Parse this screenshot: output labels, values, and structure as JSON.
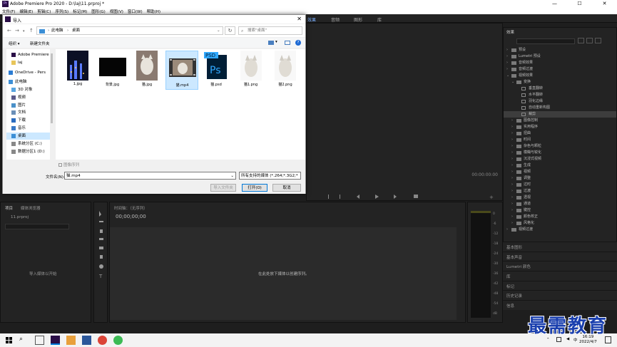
{
  "app": {
    "title": "Adobe Premiere Pro 2020 - D:\\laj\\11.prproj *",
    "icon": "Pr",
    "win_min": "—",
    "win_max": "☐",
    "win_close": "✕"
  },
  "menu": [
    "文件(F)",
    "编辑(E)",
    "剪辑(C)",
    "序列(S)",
    "标记(M)",
    "图形(G)",
    "视图(V)",
    "窗口(W)",
    "帮助(H)"
  ],
  "workspace_tabs": [
    "效果",
    "音频",
    "图形",
    "库"
  ],
  "effects_panel": {
    "title": "效果",
    "items": [
      {
        "label": "预设",
        "type": "folder",
        "level": 0,
        "expanded": false
      },
      {
        "label": "Lumetri 预设",
        "type": "folder",
        "level": 0,
        "expanded": false
      },
      {
        "label": "音频效果",
        "type": "folder",
        "level": 0,
        "expanded": false
      },
      {
        "label": "音频过渡",
        "type": "folder",
        "level": 0,
        "expanded": false
      },
      {
        "label": "视频效果",
        "type": "folder",
        "level": 0,
        "expanded": true
      },
      {
        "label": "变换",
        "type": "folder",
        "level": 1,
        "expanded": true
      },
      {
        "label": "垂直翻转",
        "type": "fx",
        "level": 2
      },
      {
        "label": "水平翻转",
        "type": "fx",
        "level": 2
      },
      {
        "label": "羽化边缘",
        "type": "fx",
        "level": 2
      },
      {
        "label": "自动重新构图",
        "type": "fx",
        "level": 2
      },
      {
        "label": "裁剪",
        "type": "fx",
        "level": 2,
        "selected": true
      },
      {
        "label": "图像控制",
        "type": "folder",
        "level": 1,
        "expanded": false
      },
      {
        "label": "实用程序",
        "type": "folder",
        "level": 1,
        "expanded": false
      },
      {
        "label": "扭曲",
        "type": "folder",
        "level": 1,
        "expanded": false
      },
      {
        "label": "时间",
        "type": "folder",
        "level": 1,
        "expanded": false
      },
      {
        "label": "杂色与颗粒",
        "type": "folder",
        "level": 1,
        "expanded": false
      },
      {
        "label": "模糊与锐化",
        "type": "folder",
        "level": 1,
        "expanded": false
      },
      {
        "label": "沉浸式视频",
        "type": "folder",
        "level": 1,
        "expanded": false
      },
      {
        "label": "生成",
        "type": "folder",
        "level": 1,
        "expanded": false
      },
      {
        "label": "视频",
        "type": "folder",
        "level": 1,
        "expanded": false
      },
      {
        "label": "调整",
        "type": "folder",
        "level": 1,
        "expanded": false
      },
      {
        "label": "过时",
        "type": "folder",
        "level": 1,
        "expanded": false
      },
      {
        "label": "过渡",
        "type": "folder",
        "level": 1,
        "expanded": false
      },
      {
        "label": "透视",
        "type": "folder",
        "level": 1,
        "expanded": false
      },
      {
        "label": "通道",
        "type": "folder",
        "level": 1,
        "expanded": false
      },
      {
        "label": "键控",
        "type": "folder",
        "level": 1,
        "expanded": false
      },
      {
        "label": "颜色校正",
        "type": "folder",
        "level": 1,
        "expanded": false
      },
      {
        "label": "风格化",
        "type": "folder",
        "level": 1,
        "expanded": false
      },
      {
        "label": "视频过渡",
        "type": "folder",
        "level": 0,
        "expanded": false
      }
    ]
  },
  "right_panels": [
    "基本图形",
    "基本声音",
    "Lumetri 颜色",
    "库",
    "标记",
    "历史记录",
    "信息"
  ],
  "program_monitor": {
    "timecode": "00:00:00:00"
  },
  "project_panel": {
    "tab1": "项目",
    "tab2": "媒体浏览器",
    "project_file": "11.prproj",
    "hint": "导入媒体以开始"
  },
  "timeline": {
    "title": "时间轴：（无序列）",
    "timecode": "00;00;00;00",
    "hint": "在此处放下媒体以创建序列。"
  },
  "audio_meter": {
    "ticks": [
      "0",
      "-6",
      "-12",
      "-18",
      "-24",
      "-30",
      "-36",
      "-42",
      "-48",
      "-54",
      "dB"
    ]
  },
  "dialog": {
    "title": "导入",
    "close": "✕",
    "breadcrumb": [
      "此电脑",
      "桌面"
    ],
    "search_placeholder": "搜索\"桌面\"",
    "organize": "组织 ▾",
    "new_folder": "新建文件夹",
    "nav": [
      {
        "label": "Adobe Premiere",
        "icon": "premiere-icon"
      },
      {
        "label": "laj",
        "icon": "folder-icon"
      },
      {
        "label": "OneDrive - Pers",
        "icon": "onedrive-icon"
      },
      {
        "label": "此电脑",
        "icon": "computer-icon"
      },
      {
        "label": "3D 对象",
        "icon": "3d-objects-icon"
      },
      {
        "label": "视频",
        "icon": "video-folder-icon"
      },
      {
        "label": "图片",
        "icon": "pictures-folder-icon"
      },
      {
        "label": "文档",
        "icon": "documents-folder-icon"
      },
      {
        "label": "下载",
        "icon": "downloads-folder-icon"
      },
      {
        "label": "音乐",
        "icon": "music-folder-icon"
      },
      {
        "label": "桌面",
        "icon": "desktop-folder-icon",
        "selected": true
      },
      {
        "label": "系统分区 (C:)",
        "icon": "drive-icon"
      },
      {
        "label": "数据分区1 (D:)",
        "icon": "drive-icon"
      }
    ],
    "files": [
      {
        "name": "1.jpg",
        "kind": "city-night"
      },
      {
        "name": "背景.jpg",
        "kind": "black"
      },
      {
        "name": "猫.jpg",
        "kind": "cat"
      },
      {
        "name": "猫.mp4",
        "kind": "video",
        "selected": true
      },
      {
        "name": "猫.psd",
        "kind": "psd"
      },
      {
        "name": "猫1.png",
        "kind": "cat-png"
      },
      {
        "name": "猫2.png",
        "kind": "cat-png"
      }
    ],
    "image_sequence": "图像序列",
    "filename_label": "文件名(N):",
    "filename_value": "猫.mp4",
    "filetype": "所有支持的媒体 (*.264;*.3G2;*",
    "import_folder": "导入文件夹",
    "open": "打开(O)",
    "cancel": "取消"
  },
  "taskbar": {
    "time": "16:19",
    "date": "2022/4/7",
    "lang": "中"
  },
  "watermark": "最需教育"
}
